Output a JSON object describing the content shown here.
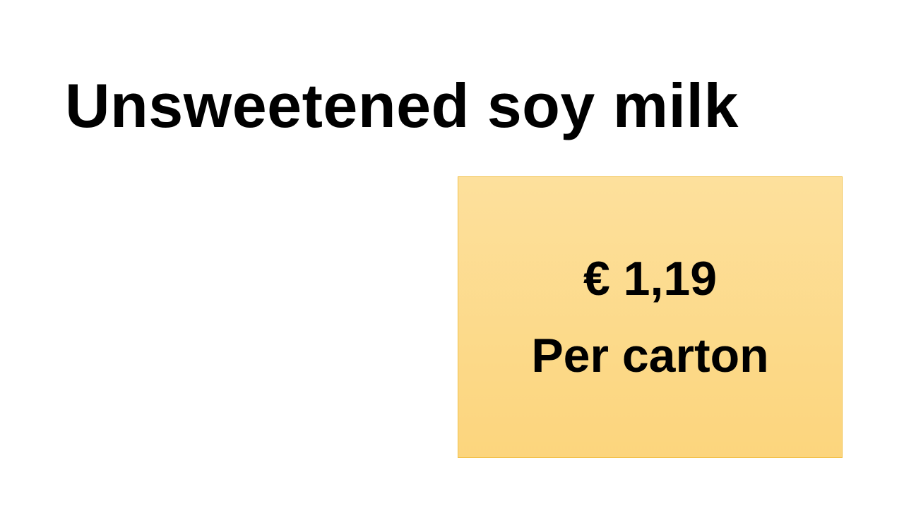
{
  "slide": {
    "title": "Unsweetened soy milk",
    "price_box": {
      "price": "€ 1,19",
      "unit": "Per carton",
      "fill_color": "#fdd98a",
      "border_color": "#f2c14a"
    }
  }
}
